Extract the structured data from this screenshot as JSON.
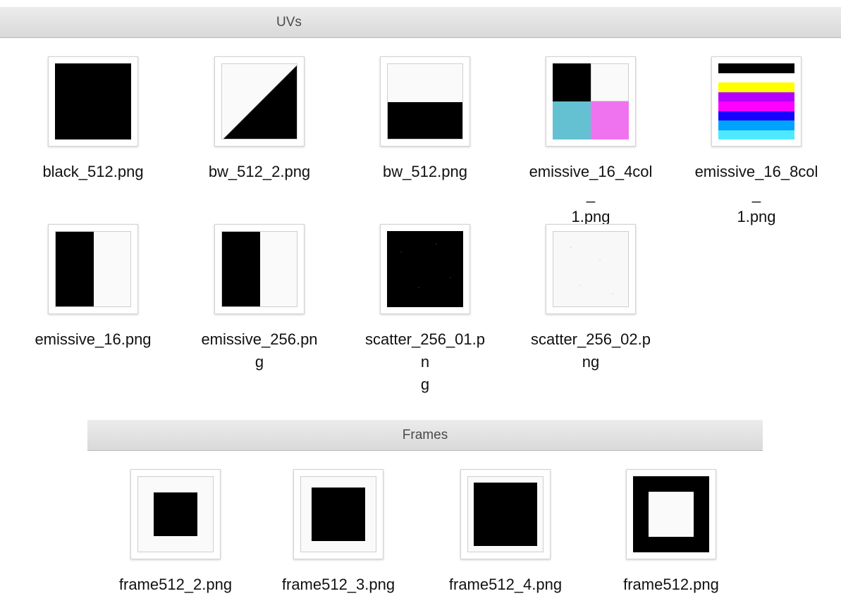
{
  "groups": {
    "uvs": {
      "title": "UVs",
      "files": [
        {
          "name": "black_512.png",
          "line1": "black_512.png",
          "line2": ""
        },
        {
          "name": "bw_512_2.png",
          "line1": "bw_512_2.png",
          "line2": ""
        },
        {
          "name": "bw_512.png",
          "line1": "bw_512.png",
          "line2": ""
        },
        {
          "name": "emissive_16_4col_1.png",
          "line1": "emissive_16_4col_",
          "line2": "1.png"
        },
        {
          "name": "emissive_16_8col_1.png",
          "line1": "emissive_16_8col_",
          "line2": "1.png"
        },
        {
          "name": "emissive_16.png",
          "line1": "emissive_16.png",
          "line2": ""
        },
        {
          "name": "emissive_256.png",
          "line1": "emissive_256.png",
          "line2": ""
        },
        {
          "name": "scatter_256_01.png",
          "line1": "scatter_256_01.pn",
          "line2": "g"
        },
        {
          "name": "scatter_256_02.png",
          "line1": "scatter_256_02.p",
          "line2": "ng"
        }
      ]
    },
    "frames": {
      "title": "Frames",
      "files": [
        {
          "name": "frame512_2.png"
        },
        {
          "name": "frame512_3.png"
        },
        {
          "name": "frame512_4.png"
        },
        {
          "name": "frame512.png"
        }
      ]
    }
  },
  "colors": {
    "black": "#000000",
    "white": "#ffffff",
    "cyan": "#63c1d1",
    "magenta": "#ef73ef",
    "yellow": "#ffff00",
    "purple": "#b400ff",
    "pink_magenta": "#ff00ff",
    "blue": "#1a00ff",
    "sky": "#00a2ff",
    "light_cyan": "#4fe8ff"
  }
}
